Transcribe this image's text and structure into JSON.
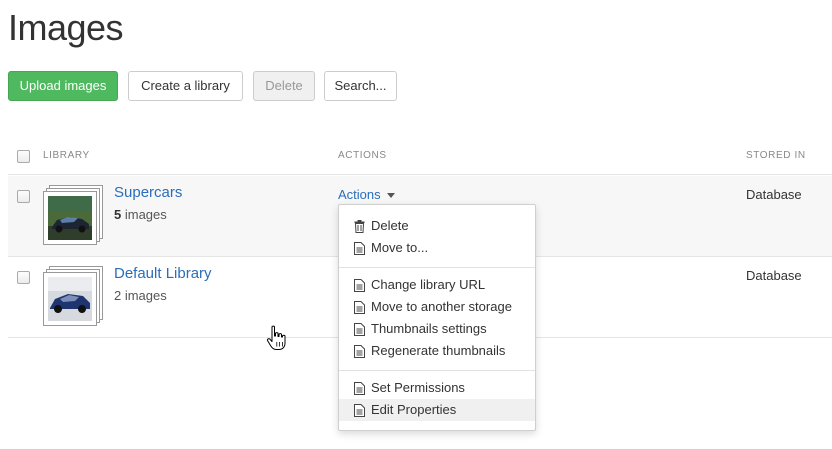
{
  "page": {
    "title": "Images"
  },
  "toolbar": {
    "upload_label": "Upload images",
    "create_label": "Create a library",
    "delete_label": "Delete",
    "search_label": "Search..."
  },
  "table": {
    "columns": {
      "library": "LIBRARY",
      "actions": "ACTIONS",
      "stored_in": "STORED IN"
    },
    "rows": [
      {
        "name": "Supercars",
        "count": "5",
        "count_suffix": " images",
        "stored_in": "Database",
        "actions_label": "Actions"
      },
      {
        "name": "Default Library",
        "count_text": "2 images",
        "stored_in": "Database"
      }
    ]
  },
  "dropdown": {
    "groups": [
      [
        {
          "label": "Delete",
          "icon": "trash-icon"
        },
        {
          "label": "Move to...",
          "icon": "document-icon"
        }
      ],
      [
        {
          "label": "Change library URL",
          "icon": "document-icon"
        },
        {
          "label": "Move to another storage",
          "icon": "document-icon"
        },
        {
          "label": "Thumbnails settings",
          "icon": "document-icon"
        },
        {
          "label": "Regenerate thumbnails",
          "icon": "document-icon"
        }
      ],
      [
        {
          "label": "Set Permissions",
          "icon": "document-icon"
        },
        {
          "label": "Edit Properties",
          "icon": "document-icon",
          "highlighted": true
        }
      ]
    ]
  },
  "colors": {
    "primary_button": "#4fb95f",
    "link": "#2a6ebb"
  }
}
